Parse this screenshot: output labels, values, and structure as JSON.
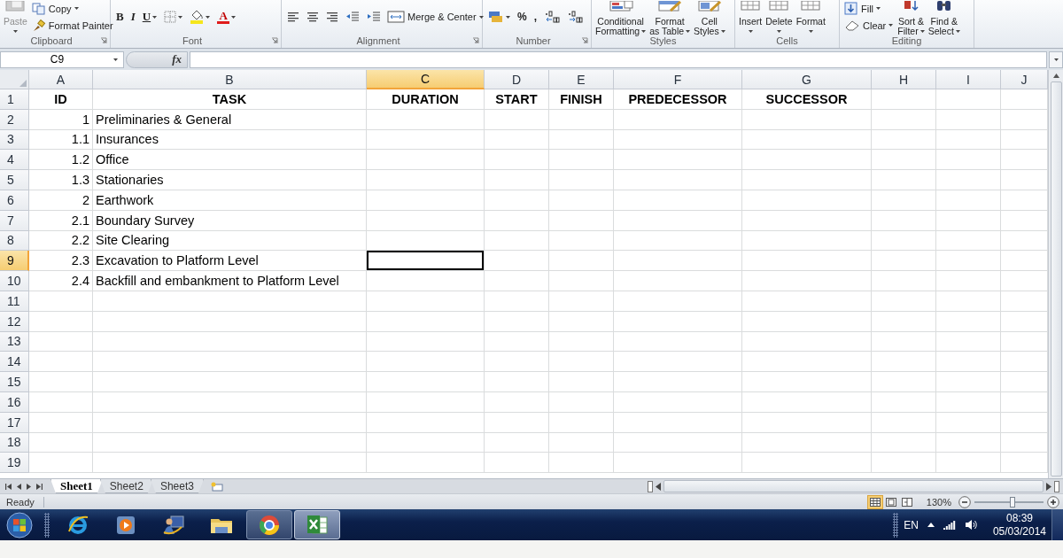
{
  "ribbon": {
    "groups": [
      {
        "label": "Clipboard",
        "launcher": true,
        "items": [
          {
            "kind": "large",
            "lines": [
              "Paste"
            ],
            "dropdown": true,
            "disabled": true
          },
          {
            "kind": "stack",
            "items": [
              {
                "kind": "small",
                "label": "Copy",
                "dropdown": true,
                "disabled": false
              },
              {
                "kind": "small",
                "label": "Format Painter",
                "dropdown": false,
                "disabled": false
              }
            ]
          }
        ]
      },
      {
        "label": "Font",
        "launcher": true,
        "items": [
          {
            "kind": "glyph",
            "label": "B",
            "dropdown": false
          },
          {
            "kind": "glyph",
            "label": "I",
            "dropdown": false
          },
          {
            "kind": "glyph",
            "label": "U",
            "dropdown": true
          },
          {
            "kind": "icon",
            "dropdown": true
          },
          {
            "kind": "icon",
            "dropdown": true
          },
          {
            "kind": "glyph",
            "label": "A",
            "dropdown": true
          }
        ]
      },
      {
        "label": "Alignment",
        "launcher": true,
        "items": [
          {
            "kind": "icon",
            "dropdown": false
          },
          {
            "kind": "icon",
            "dropdown": false
          },
          {
            "kind": "icon",
            "dropdown": false
          },
          {
            "kind": "icon",
            "dropdown": false
          },
          {
            "kind": "icon",
            "dropdown": false
          },
          {
            "kind": "small",
            "label": "Merge & Center",
            "dropdown": true
          }
        ]
      },
      {
        "label": "Number",
        "launcher": true,
        "items": [
          {
            "kind": "icon",
            "dropdown": true
          },
          {
            "kind": "glyph",
            "label": "%",
            "dropdown": false
          },
          {
            "kind": "glyph",
            "label": ",",
            "dropdown": false
          },
          {
            "kind": "icon",
            "dropdown": false
          },
          {
            "kind": "icon",
            "dropdown": false
          }
        ]
      },
      {
        "label": "Styles",
        "launcher": false,
        "items": [
          {
            "kind": "large",
            "lines": [
              "Conditional",
              "Formatting"
            ],
            "dropdown": true
          },
          {
            "kind": "large",
            "lines": [
              "Format",
              "as Table"
            ],
            "dropdown": true
          },
          {
            "kind": "large",
            "lines": [
              "Cell",
              "Styles"
            ],
            "dropdown": true
          }
        ]
      },
      {
        "label": "Cells",
        "launcher": false,
        "items": [
          {
            "kind": "large",
            "lines": [
              "Insert"
            ],
            "dropdown": true
          },
          {
            "kind": "large",
            "lines": [
              "Delete"
            ],
            "dropdown": true
          },
          {
            "kind": "large",
            "lines": [
              "Format"
            ],
            "dropdown": true
          }
        ]
      },
      {
        "label": "Editing",
        "launcher": false,
        "items": [
          {
            "kind": "stack",
            "items": [
              {
                "kind": "small",
                "label": "Fill",
                "dropdown": true
              },
              {
                "kind": "small",
                "label": "Clear",
                "dropdown": true
              }
            ]
          },
          {
            "kind": "large",
            "lines": [
              "Sort &",
              "Filter"
            ],
            "dropdown": true
          },
          {
            "kind": "large",
            "lines": [
              "Find &",
              "Select"
            ],
            "dropdown": true
          }
        ]
      }
    ]
  },
  "formula_bar": {
    "name_box": "C9",
    "function_label": "fx"
  },
  "sheet": {
    "columns": [
      {
        "letter": "A",
        "selected": false
      },
      {
        "letter": "B",
        "selected": false
      },
      {
        "letter": "C",
        "selected": true
      },
      {
        "letter": "D",
        "selected": false
      },
      {
        "letter": "E",
        "selected": false
      },
      {
        "letter": "F",
        "selected": false
      },
      {
        "letter": "G",
        "selected": false
      },
      {
        "letter": "H",
        "selected": false
      },
      {
        "letter": "I",
        "selected": false
      },
      {
        "letter": "J",
        "selected": false
      }
    ],
    "rows": [
      {
        "number": "1",
        "selected": false,
        "kind": "header",
        "cells": [
          {
            "value": "ID"
          },
          {
            "value": "TASK"
          },
          {
            "value": "DURATION"
          },
          {
            "value": "START"
          },
          {
            "value": "FINISH"
          },
          {
            "value": "PREDECESSOR"
          },
          {
            "value": "SUCCESSOR"
          }
        ]
      },
      {
        "number": "2",
        "selected": false,
        "kind": "data",
        "cells": [
          {
            "value": "1",
            "kind": "number"
          },
          {
            "value": "Preliminaries & General",
            "kind": "text"
          }
        ]
      },
      {
        "number": "3",
        "selected": false,
        "kind": "data",
        "cells": [
          {
            "value": "1.1",
            "kind": "number"
          },
          {
            "value": "Insurances",
            "kind": "text"
          }
        ]
      },
      {
        "number": "4",
        "selected": false,
        "kind": "data",
        "cells": [
          {
            "value": "1.2",
            "kind": "number"
          },
          {
            "value": "Office",
            "kind": "text"
          }
        ]
      },
      {
        "number": "5",
        "selected": false,
        "kind": "data",
        "cells": [
          {
            "value": "1.3",
            "kind": "number"
          },
          {
            "value": "Stationaries",
            "kind": "text"
          }
        ]
      },
      {
        "number": "6",
        "selected": false,
        "kind": "data",
        "cells": [
          {
            "value": "2",
            "kind": "number"
          },
          {
            "value": "Earthwork",
            "kind": "text"
          }
        ]
      },
      {
        "number": "7",
        "selected": false,
        "kind": "data",
        "cells": [
          {
            "value": "2.1",
            "kind": "number"
          },
          {
            "value": "Boundary Survey",
            "kind": "text"
          }
        ]
      },
      {
        "number": "8",
        "selected": false,
        "kind": "data",
        "cells": [
          {
            "value": "2.2",
            "kind": "number"
          },
          {
            "value": "Site Clearing",
            "kind": "text"
          }
        ]
      },
      {
        "number": "9",
        "selected": true,
        "kind": "data",
        "cells": [
          {
            "value": "2.3",
            "kind": "number"
          },
          {
            "value": "Excavation to Platform Level",
            "kind": "text"
          }
        ]
      },
      {
        "number": "10",
        "selected": false,
        "kind": "data",
        "cells": [
          {
            "value": "2.4",
            "kind": "number"
          },
          {
            "value": "Backfill and embankment to Platform Level",
            "kind": "text"
          }
        ]
      },
      {
        "number": "11",
        "selected": false,
        "cells": []
      },
      {
        "number": "12",
        "selected": false,
        "cells": []
      },
      {
        "number": "13",
        "selected": false,
        "cells": []
      },
      {
        "number": "14",
        "selected": false,
        "cells": []
      },
      {
        "number": "15",
        "selected": false,
        "cells": []
      },
      {
        "number": "16",
        "selected": false,
        "cells": []
      },
      {
        "number": "17",
        "selected": false,
        "cells": []
      },
      {
        "number": "18",
        "selected": false,
        "cells": []
      },
      {
        "number": "19",
        "selected": false,
        "cells": []
      }
    ]
  },
  "sheet_tabs": [
    {
      "label": "Sheet1",
      "selected": true
    },
    {
      "label": "Sheet2",
      "selected": false
    },
    {
      "label": "Sheet3",
      "selected": false
    }
  ],
  "status_bar": {
    "status": "Ready",
    "views": [
      {
        "selected": true
      },
      {
        "selected": false
      },
      {
        "selected": false
      }
    ],
    "zoom": "130%",
    "zoom_slider": {
      "level": 0.56
    }
  },
  "taskbar": {
    "apps": [
      {
        "running": false,
        "selected": false
      },
      {
        "running": false,
        "selected": false
      },
      {
        "running": false,
        "selected": false
      },
      {
        "running": false,
        "selected": false
      },
      {
        "running": true,
        "selected": false
      },
      {
        "running": true,
        "selected": true
      }
    ],
    "language": "EN",
    "time": "08:39",
    "date": "05/03/2014"
  }
}
